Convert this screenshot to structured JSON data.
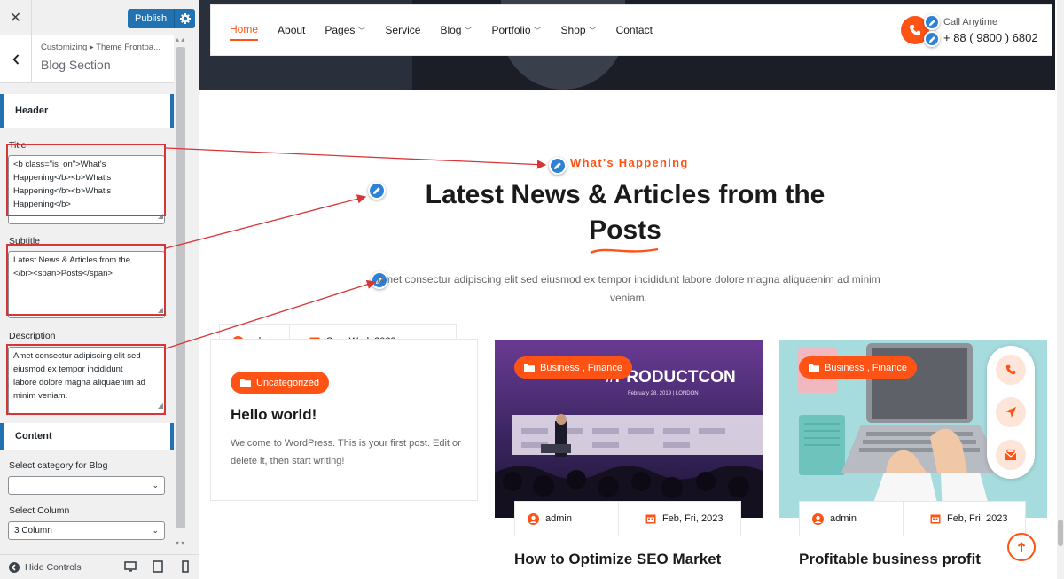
{
  "customizer": {
    "close_glyph": "✕",
    "publish_label": "Publish",
    "breadcrumb": "Customizing ▸ Theme Frontpa...",
    "section_title": "Blog Section",
    "header_group": "Header",
    "title_label": "Title",
    "title_value": "<b class=\"is_on\">What's\nHappening</b><b>What's\nHappening</b><b>What's\nHappening</b>",
    "subtitle_label": "Subtitle",
    "subtitle_value": "Latest News & Articles from the\n</br><span>Posts</span>",
    "description_label": "Description",
    "description_value": "Amet consectur adipiscing elit sed\neiusmod ex tempor incididunt\nlabore dolore magna aliquaenim ad\nminim veniam.",
    "content_group": "Content",
    "category_label": "Select category for Blog",
    "category_value": "",
    "column_label": "Select Column",
    "column_value": "3 Column",
    "hide_controls": "Hide Controls",
    "highlight_color": "#d63638",
    "accent_color": "#2271b1"
  },
  "site": {
    "nav": [
      "Home",
      "About",
      "Pages",
      "Service",
      "Blog",
      "Portfolio",
      "Shop",
      "Contact"
    ],
    "nav_dropdown": [
      false,
      false,
      true,
      false,
      true,
      true,
      true,
      false
    ],
    "call_label": "Call Anytime",
    "call_number": "+ 88 ( 9800 ) 6802",
    "eyebrow": "What's Happening",
    "headline_line1": "Latest News & Articles from the",
    "headline_line2": "Posts",
    "description": "Amet consectur adipiscing elit sed eiusmod ex tempor incididunt labore dolore magna aliquaenim ad minim veniam.",
    "brand_color": "#ff5316",
    "posts": [
      {
        "author": "admin",
        "date": "Sep, Wed, 2023",
        "category": "Uncategorized",
        "title": "Hello world!",
        "excerpt": "Welcome to WordPress. This is your first post. Edit or delete it, then start writing!"
      },
      {
        "author": "admin",
        "date": "Feb, Fri, 2023",
        "category": "Business , Finance",
        "title": "How to Optimize SEO Market",
        "image_text": "#PRODUCTCON",
        "image_sub": "February 28, 2019 | LONDON"
      },
      {
        "author": "admin",
        "date": "Feb, Fri, 2023",
        "category": "Business , Finance",
        "title": "Profitable business profit"
      }
    ]
  }
}
